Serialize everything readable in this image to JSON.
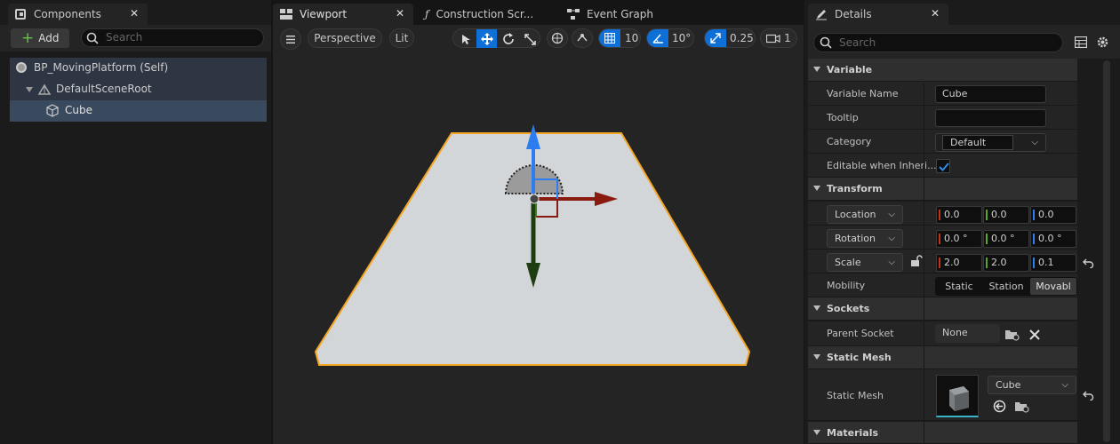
{
  "components_panel": {
    "tab_label": "Components",
    "add_label": "Add",
    "search_placeholder": "Search",
    "tree": [
      {
        "label": "BP_MovingPlatform (Self)"
      },
      {
        "label": "DefaultSceneRoot"
      },
      {
        "label": "Cube"
      }
    ]
  },
  "editor_tabs": [
    {
      "label": "Viewport"
    },
    {
      "label": "Construction Scr..."
    },
    {
      "label": "Event Graph"
    }
  ],
  "viewport_toolbar": {
    "perspective_label": "Perspective",
    "lit_label": "Lit",
    "grid_snap": "10",
    "rotation_snap": "10°",
    "scale_snap": "0.25",
    "camera_speed": "1"
  },
  "details_panel": {
    "tab_label": "Details",
    "search_placeholder": "Search",
    "variable": {
      "section": "Variable",
      "name_label": "Variable Name",
      "name_value": "Cube",
      "tooltip_label": "Tooltip",
      "tooltip_value": "",
      "category_label": "Category",
      "category_value": "Default",
      "editable_label": "Editable when Inheri..."
    },
    "transform": {
      "section": "Transform",
      "location_label": "Location",
      "location": [
        "0.0",
        "0.0",
        "0.0"
      ],
      "rotation_label": "Rotation",
      "rotation": [
        "0.0 °",
        "0.0 °",
        "0.0 °"
      ],
      "scale_label": "Scale",
      "scale": [
        "2.0",
        "2.0",
        "0.1"
      ],
      "mobility_label": "Mobility",
      "mobility_options": [
        "Static",
        "Station",
        "Movabl"
      ]
    },
    "sockets": {
      "section": "Sockets",
      "parent_label": "Parent Socket",
      "parent_value": "None"
    },
    "static_mesh": {
      "section": "Static Mesh",
      "label": "Static Mesh",
      "value": "Cube"
    },
    "materials": {
      "section": "Materials"
    }
  },
  "colors": {
    "accent": "#0e6fd6",
    "selection_outline": "#f5a623",
    "x_axis": "#c5321b",
    "y_axis": "#5aa82a",
    "z_axis": "#2d7cf0"
  }
}
